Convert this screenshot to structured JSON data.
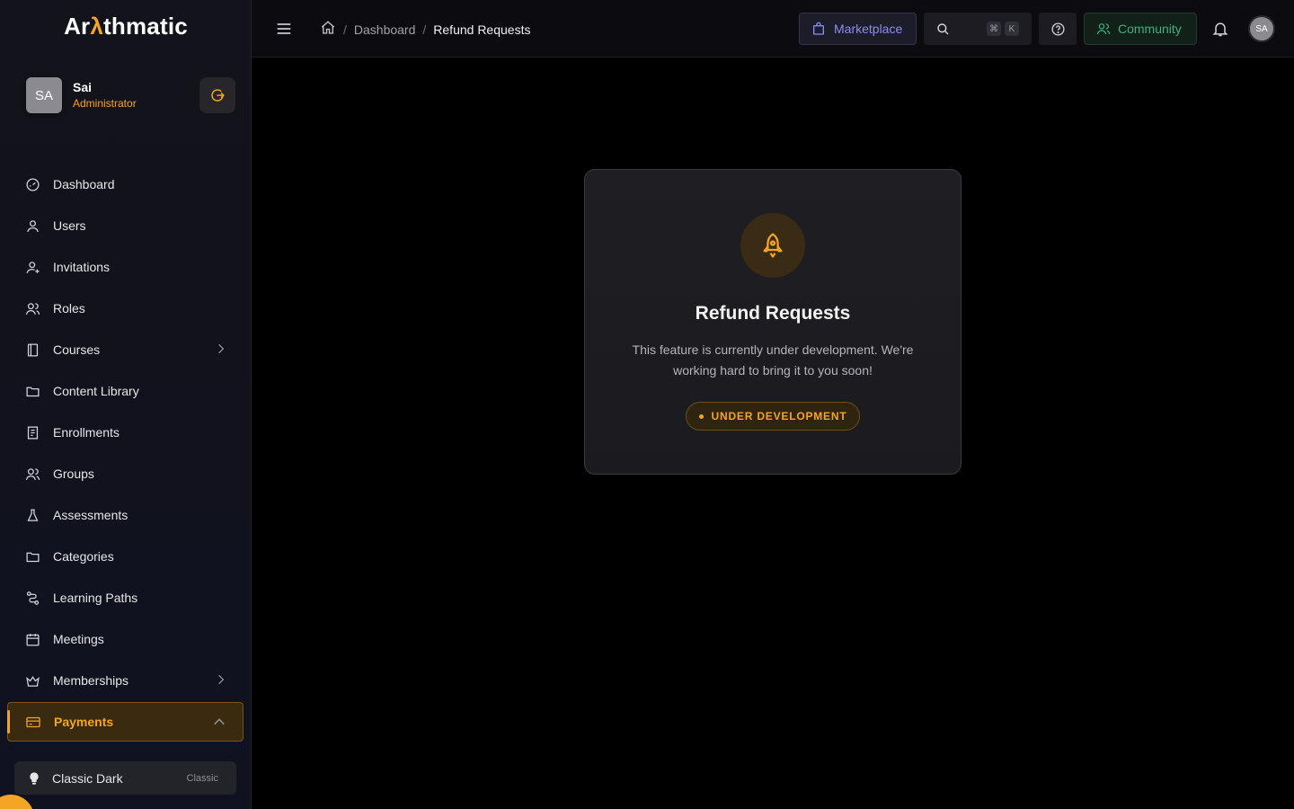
{
  "app": {
    "logo_prefix": "Ar",
    "logo_accent": "λ",
    "logo_suffix": "thmatic"
  },
  "profile": {
    "initials": "SA",
    "name": "Sai",
    "role": "Administrator"
  },
  "sidebar": {
    "items": [
      {
        "label": "Dashboard",
        "icon": "dashboard-icon"
      },
      {
        "label": "Users",
        "icon": "user-icon"
      },
      {
        "label": "Invitations",
        "icon": "user-plus-icon"
      },
      {
        "label": "Roles",
        "icon": "roles-icon"
      },
      {
        "label": "Courses",
        "icon": "book-icon"
      },
      {
        "label": "Content Library",
        "icon": "folder-icon"
      },
      {
        "label": "Enrollments",
        "icon": "receipt-icon"
      },
      {
        "label": "Groups",
        "icon": "users-icon"
      },
      {
        "label": "Assessments",
        "icon": "flask-icon"
      },
      {
        "label": "Categories",
        "icon": "folder-icon"
      },
      {
        "label": "Learning Paths",
        "icon": "route-icon"
      },
      {
        "label": "Meetings",
        "icon": "calendar-icon"
      },
      {
        "label": "Memberships",
        "icon": "crown-icon"
      },
      {
        "label": "Payments",
        "icon": "credit-card-icon"
      }
    ],
    "active": "Payments"
  },
  "theme": {
    "label": "Classic Dark",
    "tag": "Classic"
  },
  "header": {
    "breadcrumb": [
      "Dashboard",
      "Refund Requests"
    ],
    "marketplace_label": "Marketplace",
    "shortcut_keys": [
      "⌘",
      "K"
    ],
    "community_label": "Community",
    "avatar_initials": "SA"
  },
  "card": {
    "title": "Refund Requests",
    "description": "This feature is currently under development. We're working hard to bring it to you soon!",
    "badge": "UNDER DEVELOPMENT"
  },
  "colors": {
    "accent": "#f5a524",
    "marketplace": "#8b8cf0",
    "community": "#3fb07a"
  }
}
